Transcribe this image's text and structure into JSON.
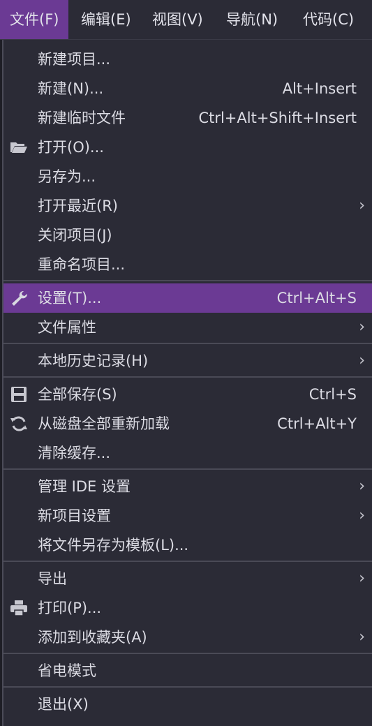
{
  "menubar": {
    "items": [
      "文件(F)",
      "编辑(E)",
      "视图(V)",
      "导航(N)",
      "代码(C)"
    ]
  },
  "menu": {
    "new_project": "新建项目...",
    "new": "新建(N)...",
    "new_shortcut": "Alt+Insert",
    "new_scratch": "新建临时文件",
    "new_scratch_shortcut": "Ctrl+Alt+Shift+Insert",
    "open": "打开(O)...",
    "save_as": "另存为...",
    "open_recent": "打开最近(R)",
    "close_project": "关闭项目(J)",
    "rename_project": "重命名项目...",
    "settings": "设置(T)...",
    "settings_shortcut": "Ctrl+Alt+S",
    "file_properties": "文件属性",
    "local_history": "本地历史记录(H)",
    "save_all": "全部保存(S)",
    "save_all_shortcut": "Ctrl+S",
    "reload_all": "从磁盘全部重新加载",
    "reload_all_shortcut": "Ctrl+Alt+Y",
    "invalidate_caches": "清除缓存...",
    "manage_ide_settings": "管理 IDE 设置",
    "new_project_settings": "新项目设置",
    "save_as_template": "将文件另存为模板(L)...",
    "export": "导出",
    "print": "打印(P)...",
    "add_to_favorites": "添加到收藏夹(A)",
    "power_save_mode": "省电模式",
    "exit": "退出(X)"
  },
  "colors": {
    "background": "#2b2b36",
    "highlight": "#6b3a94",
    "separator": "#4a4a56",
    "text": "#dcdce4"
  }
}
